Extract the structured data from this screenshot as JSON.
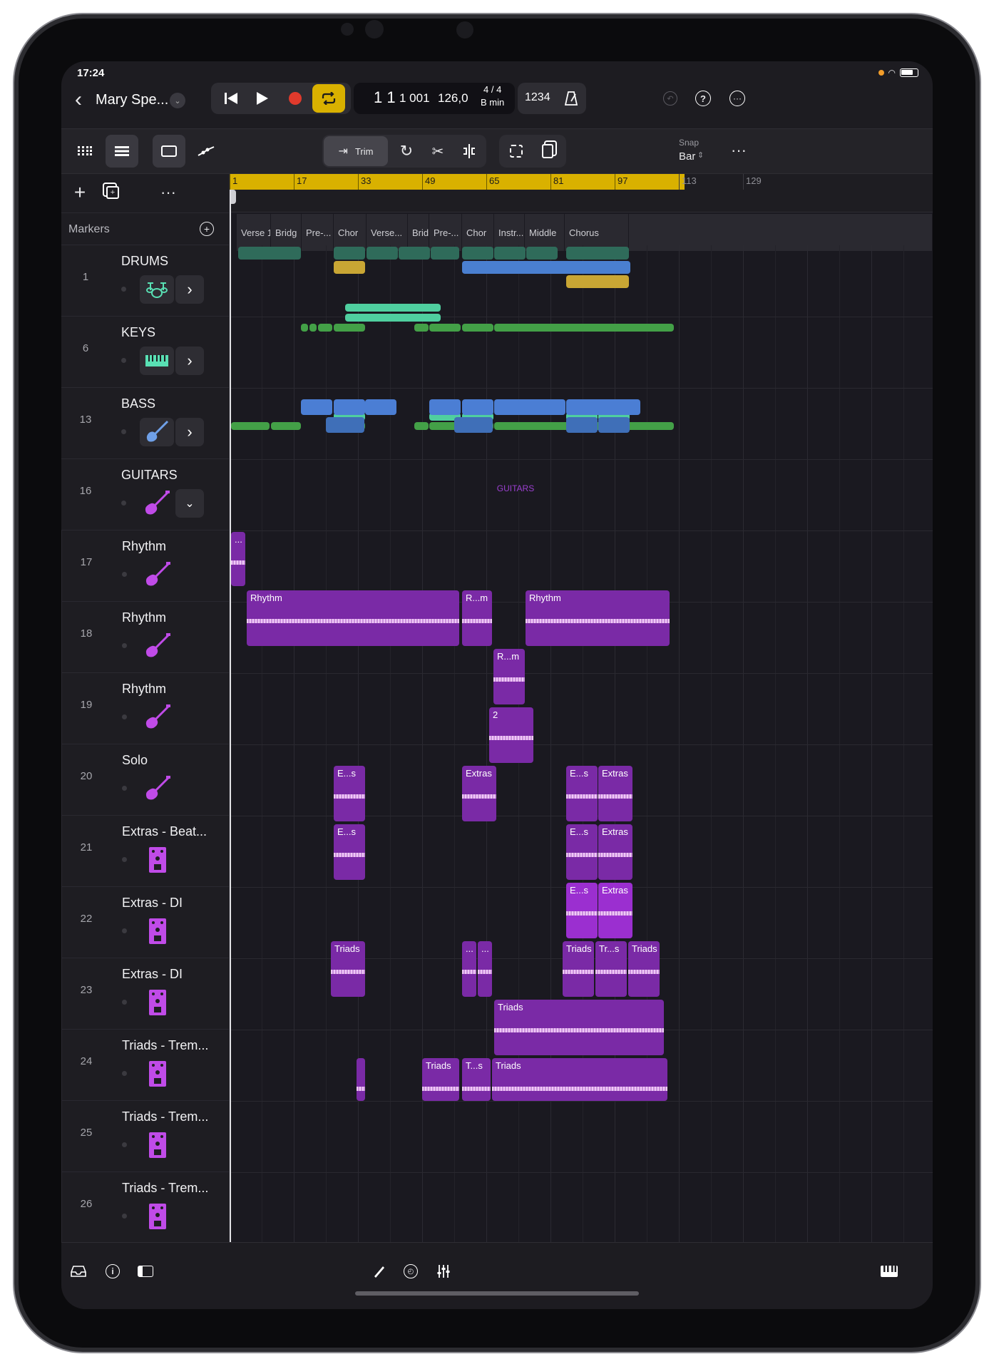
{
  "status": {
    "time": "17:24"
  },
  "header": {
    "project_title": "Mary Spe...",
    "lcd_position": "1 1",
    "lcd_ticks": "1 001",
    "lcd_tempo": "126,0",
    "lcd_signature": "4 / 4",
    "lcd_key": "B min",
    "count_in_label": "1234"
  },
  "toolbar": {
    "trim_label": "Trim",
    "snap_label": "Snap",
    "snap_value": "Bar"
  },
  "ruler": {
    "bars": [
      "1",
      "17",
      "33",
      "49",
      "65",
      "81",
      "97",
      "113",
      "129"
    ]
  },
  "markers_header": "Markers",
  "markers": [
    "Verse 1",
    "Bridg",
    "Pre-...",
    "Chor",
    "Verse...",
    "Bridg",
    "Pre-...",
    "Chor",
    "Instr...",
    "Middle",
    "Chorus"
  ],
  "folder_label": "GUITARS",
  "tracks": [
    {
      "num": "1",
      "name": "DRUMS"
    },
    {
      "num": "6",
      "name": "KEYS"
    },
    {
      "num": "13",
      "name": "BASS"
    },
    {
      "num": "16",
      "name": "GUITARS"
    },
    {
      "num": "17",
      "name": "Rhythm"
    },
    {
      "num": "18",
      "name": "Rhythm"
    },
    {
      "num": "19",
      "name": "Rhythm"
    },
    {
      "num": "20",
      "name": "Solo"
    },
    {
      "num": "21",
      "name": "Extras - Beat..."
    },
    {
      "num": "22",
      "name": "Extras - DI"
    },
    {
      "num": "23",
      "name": "Extras - DI"
    },
    {
      "num": "24",
      "name": "Triads - Trem..."
    },
    {
      "num": "25",
      "name": "Triads - Trem..."
    },
    {
      "num": "26",
      "name": "Triads - Trem..."
    }
  ],
  "regions": {
    "r17": "...",
    "r18a": "Rhythm",
    "r18b": "R...m",
    "r18c": "Rhythm",
    "r19": "R...m",
    "r20": "2",
    "r21a": "E...s",
    "r21b": "Extras",
    "r21c": "E...s",
    "r21d": "Extras",
    "r22a": "E...s",
    "r22b": "E...s",
    "r22c": "Extras",
    "r23a": "E...s",
    "r23b": "Extras",
    "r24a": "Triads",
    "r24b": "...",
    "r24c": "...",
    "r24d": "Triads",
    "r24e": "Tr...s",
    "r24f": "Triads",
    "r25": "Triads",
    "r26a": "Triads",
    "r26b": "T...s",
    "r26c": "Triads"
  },
  "colors": {
    "cycle": "#d9b100",
    "record": "#e03a2c",
    "guitar": "#7a2aa6",
    "guitar_light": "#9b2fd0",
    "drums_dark": "#2f6b5a",
    "drums_gold": "#c9a634",
    "drums_blue": "#4a7fd0",
    "keys_green": "#43a047",
    "keys_teal": "#4fcf9f",
    "bass_blue": "#4b7ed4"
  },
  "icons": [
    "chevron-left-icon",
    "rewind-icon",
    "play-icon",
    "record-icon",
    "cycle-icon",
    "metronome-icon",
    "undo-icon",
    "help-icon",
    "more-icon",
    "grid-view-icon",
    "tracks-view-icon",
    "window-icon",
    "automation-icon",
    "trim-icon",
    "loop-icon",
    "scissors-icon",
    "split-icon",
    "copy-icon",
    "paste-icon",
    "plus-icon",
    "duplicate-icon",
    "drum-kit-icon",
    "keyboard-icon",
    "guitar-icon",
    "pedal-icon",
    "inbox-icon",
    "info-icon",
    "sidebar-icon",
    "pencil-icon",
    "timer-icon",
    "mixer-icon",
    "piano-icon"
  ]
}
